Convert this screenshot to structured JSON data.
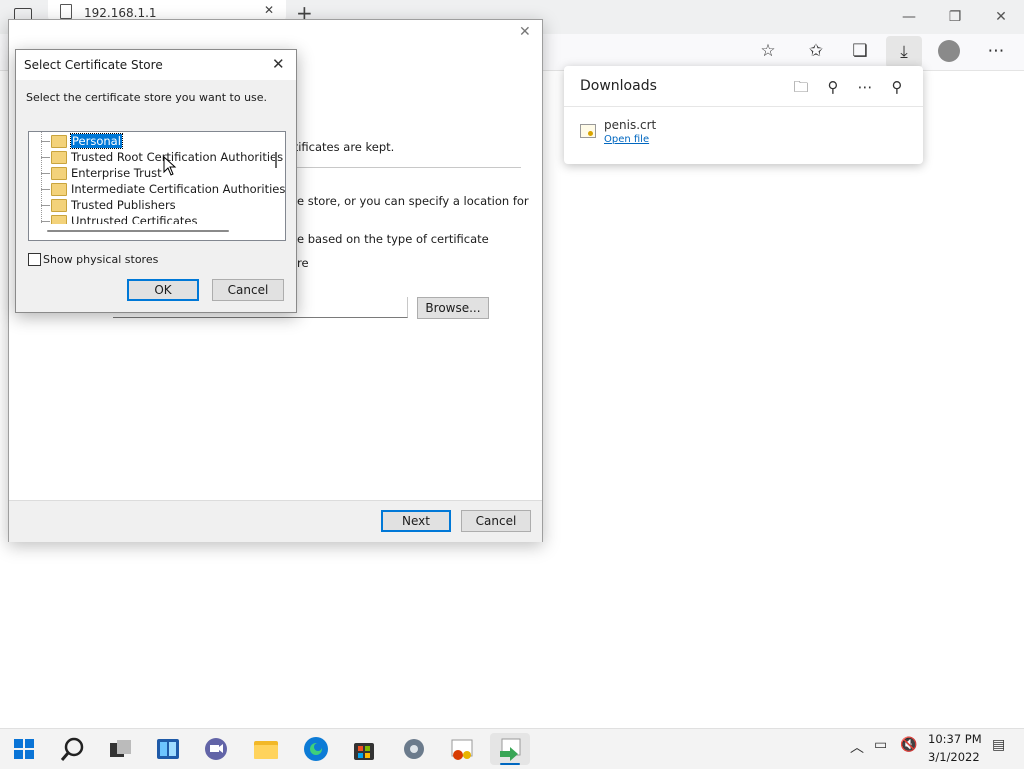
{
  "browser": {
    "tab_title": "192.168.1.1",
    "downloads": {
      "title": "Downloads",
      "file_name": "penis.crt",
      "open_link": "Open file"
    }
  },
  "wizard": {
    "text_kept": "rtificates are kept.",
    "text_specify": "e store, or you can specify a location for",
    "text_based": "e based on the type of certificate",
    "text_re": "re",
    "browse_label": "Browse...",
    "next_label": "Next",
    "cancel_label": "Cancel"
  },
  "dialog": {
    "title": "Select Certificate Store",
    "instruction": "Select the certificate store you want to use.",
    "stores": [
      "Personal",
      "Trusted Root Certification Authorities",
      "Enterprise Trust",
      "Intermediate Certification Authorities",
      "Trusted Publishers",
      "Untrusted Certificates"
    ],
    "selected_store": "Personal",
    "show_physical_label": "Show physical stores",
    "show_physical_checked": false,
    "ok_label": "OK",
    "cancel_label": "Cancel"
  },
  "taskbar": {
    "time": "10:37 PM",
    "date": "3/1/2022",
    "apps": [
      "start-icon",
      "search-icon",
      "task-view-icon",
      "widgets-icon",
      "teams-chat-icon",
      "file-explorer-icon",
      "edge-icon",
      "store-icon",
      "settings-icon",
      "certificate-app-icon",
      "certificate-import-icon"
    ]
  },
  "colors": {
    "accent": "#0078d7",
    "link": "#0067c0",
    "folder": "#f3d27a"
  }
}
